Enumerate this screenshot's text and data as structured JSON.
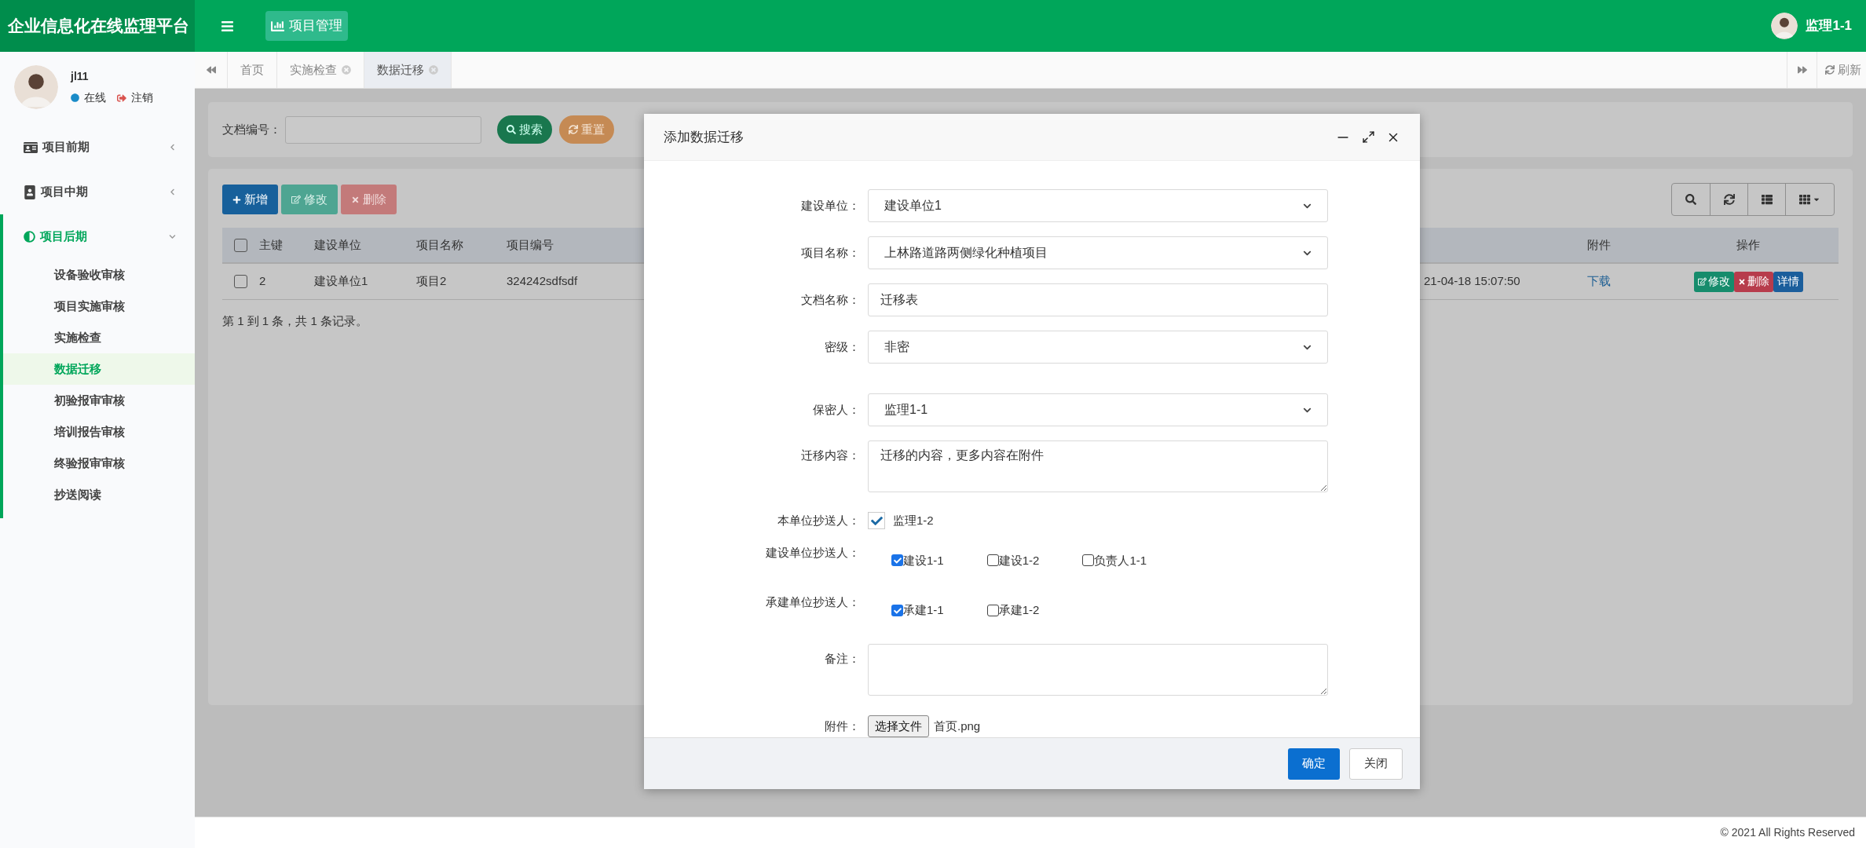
{
  "header": {
    "title": "企业信息化在线监理平台",
    "module": "项目管理",
    "user": "监理1-1"
  },
  "sidebar": {
    "user": {
      "name": "jl11",
      "status": "在线",
      "logout": "注销"
    },
    "menu": [
      {
        "label": "项目前期",
        "expanded": false
      },
      {
        "label": "项目中期",
        "expanded": false
      },
      {
        "label": "项目后期",
        "expanded": true,
        "children": [
          {
            "label": "设备验收审核",
            "selected": false
          },
          {
            "label": "项目实施审核",
            "selected": false
          },
          {
            "label": "实施检查",
            "selected": false
          },
          {
            "label": "数据迁移",
            "selected": true
          },
          {
            "label": "初验报审审核",
            "selected": false
          },
          {
            "label": "培训报告审核",
            "selected": false
          },
          {
            "label": "终验报审审核",
            "selected": false
          },
          {
            "label": "抄送阅读",
            "selected": false
          }
        ]
      }
    ]
  },
  "tabs": [
    {
      "label": "首页",
      "selected": false,
      "closable": false
    },
    {
      "label": "实施检查",
      "selected": false,
      "closable": true
    },
    {
      "label": "数据迁移",
      "selected": true,
      "closable": true
    }
  ],
  "refresh": "刷新",
  "search": {
    "label": "文档编号：",
    "search_button": "搜索",
    "reset_button": "重置"
  },
  "toolbar": [
    "新增",
    "修改",
    "删除"
  ],
  "table": {
    "header_checked": false,
    "columns_left": [
      "主键",
      "建设单位",
      "项目名称",
      "项目编号"
    ],
    "columns_right": [
      "附件",
      "操作"
    ],
    "rows": [
      {
        "checked": false,
        "cells": [
          "2",
          "建设单位1",
          "项目2",
          "324242sdfsdf"
        ],
        "time": "21-04-18 15:07:50",
        "attachment": "下载",
        "actions": [
          "修改",
          "删除",
          "详情"
        ]
      }
    ]
  },
  "pagination": "第 1 到 1 条，共 1 条记录。",
  "dialog": {
    "title": "添加数据迁移",
    "confirm": "确定",
    "close": "关闭",
    "fields": [
      {
        "kind": "select",
        "label": "建设单位：",
        "value": "建设单位1"
      },
      {
        "kind": "select",
        "label": "项目名称：",
        "value": "上林路道路两侧绿化种植项目"
      },
      {
        "kind": "text",
        "label": "文档名称：",
        "value": "迁移表"
      },
      {
        "kind": "select",
        "label": "密级：",
        "value": "非密"
      },
      {
        "kind": "select",
        "label": "保密人：",
        "value": "监理1-1"
      },
      {
        "kind": "textarea",
        "label": "迁移内容：",
        "value": "迁移的内容，更多内容在附件"
      },
      {
        "kind": "check_single",
        "label": "本单位抄送人：",
        "options": [
          {
            "label": "监理1-2",
            "checked": true
          }
        ]
      },
      {
        "kind": "checks",
        "label": "建设单位抄送人：",
        "options": [
          {
            "label": "建设1-1",
            "checked": true
          },
          {
            "label": "建设1-2",
            "checked": false
          },
          {
            "label": "负责人1-1",
            "checked": false
          }
        ]
      },
      {
        "kind": "checks",
        "label": "承建单位抄送人：",
        "options": [
          {
            "label": "承建1-1",
            "checked": true
          },
          {
            "label": "承建1-2",
            "checked": false
          }
        ]
      },
      {
        "kind": "textarea",
        "label": "备注："
      },
      {
        "kind": "file",
        "label": "附件：",
        "button": "选择文件",
        "value": "首页.png"
      }
    ]
  },
  "footer": "© 2021 All Rights Reserved"
}
